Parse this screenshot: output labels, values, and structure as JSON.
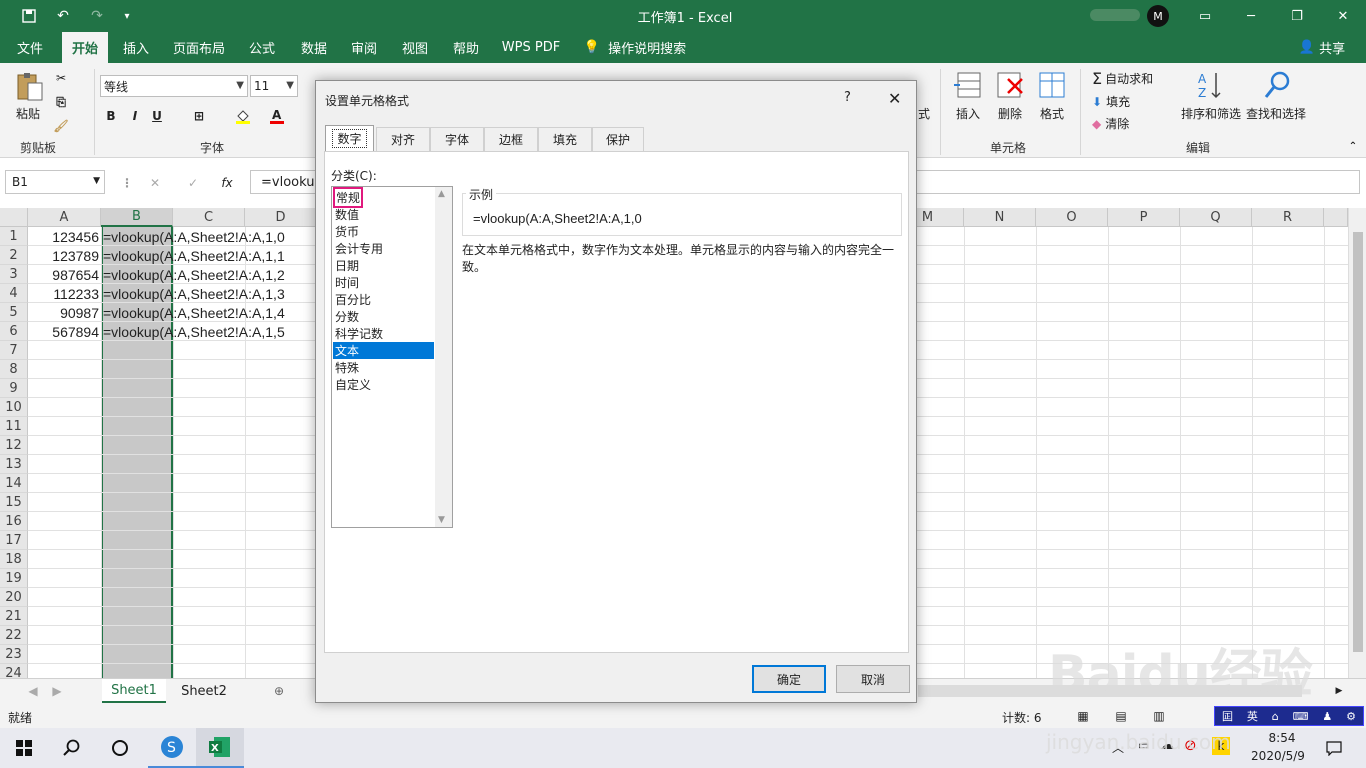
{
  "titlebar": {
    "title": "工作簿1  -  Excel",
    "avatar": "M"
  },
  "menu": {
    "tabs": [
      "文件",
      "开始",
      "插入",
      "页面布局",
      "公式",
      "数据",
      "审阅",
      "视图",
      "帮助",
      "WPS PDF",
      "操作说明搜索"
    ],
    "share": "共享"
  },
  "ribbon": {
    "paste": "粘贴",
    "clipboard": "剪贴板",
    "font_name": "等线",
    "font_size": "11",
    "font_group": "字体",
    "bold": "B",
    "italic": "I",
    "underline": "U",
    "insert": "插入",
    "delete": "删除",
    "format": "格式",
    "cells_group": "单元格",
    "autosum": "自动求和",
    "fill": "填充",
    "clear": "清除",
    "sort": "排序和筛选",
    "find": "查找和选择",
    "edit_group": "编辑",
    "format_partial": "式"
  },
  "formula_bar": {
    "name_box": "B1",
    "fx": "fx",
    "value": "=vlookup"
  },
  "grid": {
    "columns": [
      "A",
      "B",
      "C",
      "D",
      "M",
      "N",
      "O",
      "P",
      "Q",
      "R"
    ],
    "rows": [
      "1",
      "2",
      "3",
      "4",
      "5",
      "6",
      "7",
      "8",
      "9",
      "10",
      "11",
      "12",
      "13",
      "14",
      "15",
      "16",
      "17",
      "18",
      "19",
      "20",
      "21",
      "22",
      "23",
      "24"
    ],
    "data": [
      {
        "a": "123456",
        "b": "=vlookup(A:A,Sheet2!A:A,1,0"
      },
      {
        "a": "123789",
        "b": "=vlookup(A:A,Sheet2!A:A,1,1"
      },
      {
        "a": "987654",
        "b": "=vlookup(A:A,Sheet2!A:A,1,2"
      },
      {
        "a": "112233",
        "b": "=vlookup(A:A,Sheet2!A:A,1,3"
      },
      {
        "a": "90987",
        "b": "=vlookup(A:A,Sheet2!A:A,1,4"
      },
      {
        "a": "567894",
        "b": "=vlookup(A:A,Sheet2!A:A,1,5"
      }
    ]
  },
  "sheets": [
    "Sheet1",
    "Sheet2"
  ],
  "status": {
    "ready": "就绪",
    "count": "计数: 6"
  },
  "dialog": {
    "title": "设置单元格格式",
    "help": "?",
    "tabs": [
      "数字",
      "对齐",
      "字体",
      "边框",
      "填充",
      "保护"
    ],
    "category_label": "分类(C):",
    "categories": [
      "常规",
      "数值",
      "货币",
      "会计专用",
      "日期",
      "时间",
      "百分比",
      "分数",
      "科学记数",
      "文本",
      "特殊",
      "自定义"
    ],
    "selected_category": "文本",
    "sample_label": "示例",
    "sample_value": "=vlookup(A:A,Sheet2!A:A,1,0",
    "description": "在文本单元格格式中，数字作为文本处理。单元格显示的内容与输入的内容完全一致。",
    "ok": "确定",
    "cancel": "取消"
  },
  "taskbar": {
    "time": "8:54",
    "date": "2020/5/9"
  },
  "watermark": {
    "text": "Baidu经验",
    "url": "jingyan.baidu.com"
  },
  "colors": {
    "excel_green": "#217346",
    "selection_blue": "#0078d7",
    "highlight_pink": "#e0197d"
  }
}
